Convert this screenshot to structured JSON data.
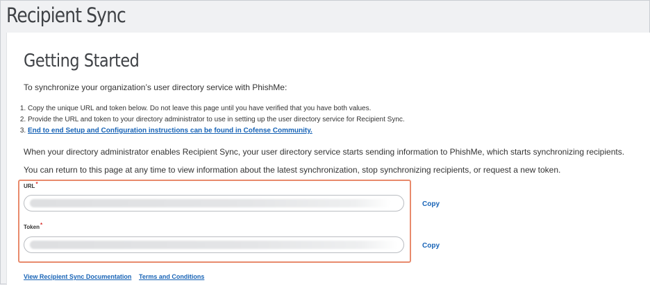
{
  "page": {
    "title": "Recipient Sync"
  },
  "getting_started": {
    "heading": "Getting Started",
    "intro": "To synchronize your organization’s user directory service with PhishMe:",
    "steps": [
      "Copy the unique URL and token below. Do not leave this page until you have verified that you have both values.",
      "Provide the URL and token to your directory administrator to use in setting up the user directory service for Recipient Sync."
    ],
    "step3_link": "End to end Setup and Configuration instructions can be found in Cofense Community.",
    "paragraph1": "When your directory administrator enables Recipient Sync, your user directory service starts sending information to PhishMe, which starts synchronizing recipients.",
    "paragraph2": "You can return to this page at any time to view information about the latest synchronization, stop synchronizing recipients, or request a new token."
  },
  "fields": {
    "url_label": "URL",
    "token_label": "Token",
    "required_mark": "*",
    "copy_label": "Copy"
  },
  "footer": {
    "documentation_link": "View Recipient Sync Documentation",
    "terms_link": "Terms and Conditions"
  },
  "colors": {
    "link": "#1763b6",
    "highlight_border": "#e88a6c",
    "required": "#d9302c"
  }
}
